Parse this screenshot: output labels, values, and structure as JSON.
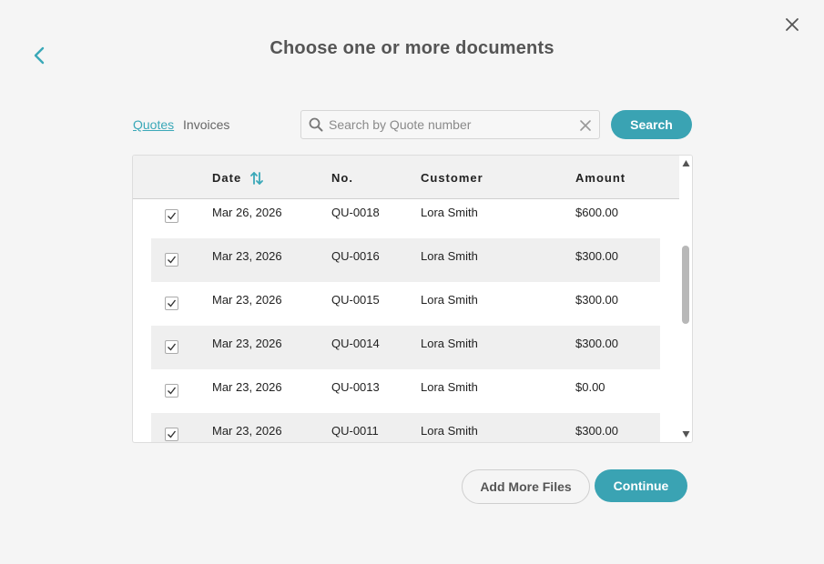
{
  "header": {
    "title": "Choose one or more documents",
    "back_icon": "chevron-left-icon",
    "close_icon": "close-icon"
  },
  "tabs": [
    {
      "label": "Quotes",
      "active": true
    },
    {
      "label": "Invoices",
      "active": false
    }
  ],
  "search": {
    "placeholder": "Search by Quote number",
    "value": "",
    "button_label": "Search"
  },
  "table": {
    "columns": {
      "date": "Date",
      "number": "No.",
      "customer": "Customer",
      "amount": "Amount"
    },
    "rows": [
      {
        "checked": true,
        "date": "Mar 26, 2026",
        "number": "QU-0018",
        "customer": "Lora Smith",
        "amount": "$600.00"
      },
      {
        "checked": true,
        "date": "Mar 23, 2026",
        "number": "QU-0016",
        "customer": "Lora Smith",
        "amount": "$300.00"
      },
      {
        "checked": true,
        "date": "Mar 23, 2026",
        "number": "QU-0015",
        "customer": "Lora Smith",
        "amount": "$300.00"
      },
      {
        "checked": true,
        "date": "Mar 23, 2026",
        "number": "QU-0014",
        "customer": "Lora Smith",
        "amount": "$300.00"
      },
      {
        "checked": true,
        "date": "Mar 23, 2026",
        "number": "QU-0013",
        "customer": "Lora Smith",
        "amount": "$0.00"
      },
      {
        "checked": true,
        "date": "Mar 23, 2026",
        "number": "QU-0011",
        "customer": "Lora Smith",
        "amount": "$300.00"
      }
    ]
  },
  "footer": {
    "add_more_label": "Add More Files",
    "continue_label": "Continue"
  },
  "colors": {
    "accent": "#3aa3b3",
    "background": "#f5f5f5"
  }
}
